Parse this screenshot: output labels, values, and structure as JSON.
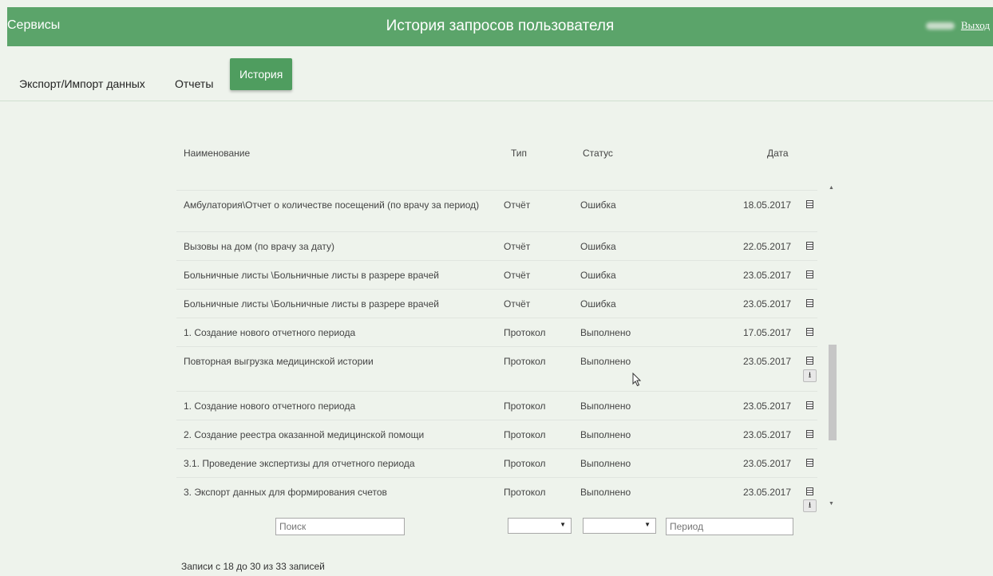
{
  "header": {
    "brand": "Сервисы",
    "title": "История запросов пользователя",
    "logout": "Выход"
  },
  "nav": {
    "tabs": [
      {
        "label": "Экспорт/Импорт данных",
        "active": false
      },
      {
        "label": "Отчеты",
        "active": false
      },
      {
        "label": "История",
        "active": true
      }
    ]
  },
  "table": {
    "columns": {
      "name": "Наименование",
      "type": "Тип",
      "status": "Статус",
      "date": "Дата"
    },
    "rows": [
      {
        "name": "Амбулатория\\Отчет о количестве посещений (по врачу за период)",
        "type": "Отчёт",
        "status": "Ошибка",
        "date": "18.05.2017",
        "icons": [
          "doc-icon"
        ]
      },
      {
        "name": "Вызовы на дом (по врачу за дату)",
        "type": "Отчёт",
        "status": "Ошибка",
        "date": "22.05.2017",
        "icons": [
          "doc-icon"
        ]
      },
      {
        "name": "Больничные листы \\Больничные листы в разрере врачей",
        "type": "Отчёт",
        "status": "Ошибка",
        "date": "23.05.2017",
        "icons": [
          "doc-icon"
        ]
      },
      {
        "name": "Больничные листы \\Больничные листы в разрере врачей",
        "type": "Отчёт",
        "status": "Ошибка",
        "date": "23.05.2017",
        "icons": [
          "doc-icon"
        ]
      },
      {
        "name": "1. Создание нового отчетного периода",
        "type": "Протокол",
        "status": "Выполнено",
        "date": "17.05.2017",
        "icons": [
          "doc-icon"
        ]
      },
      {
        "name": "Повторная выгрузка медицинской истории",
        "type": "Протокол",
        "status": "Выполнено",
        "date": "23.05.2017",
        "icons": [
          "doc-icon",
          "download-icon"
        ]
      },
      {
        "name": "1. Создание нового отчетного периода",
        "type": "Протокол",
        "status": "Выполнено",
        "date": "23.05.2017",
        "icons": [
          "doc-icon"
        ]
      },
      {
        "name": "2. Создание реестра оказанной медицинской помощи",
        "type": "Протокол",
        "status": "Выполнено",
        "date": "23.05.2017",
        "icons": [
          "doc-icon"
        ]
      },
      {
        "name": "3.1. Проведение экспертизы для отчетного периода",
        "type": "Протокол",
        "status": "Выполнено",
        "date": "23.05.2017",
        "icons": [
          "doc-icon"
        ]
      },
      {
        "name": "3. Экспорт данных для формирования счетов",
        "type": "Протокол",
        "status": "Выполнено",
        "date": "23.05.2017",
        "icons": [
          "doc-icon",
          "download-icon"
        ]
      }
    ]
  },
  "filters": {
    "search_placeholder": "Поиск",
    "type_value": "",
    "status_value": "",
    "period_placeholder": "Период"
  },
  "footer": {
    "records": "Записи с 18 до 30 из 33 записей"
  },
  "colors": {
    "topbar": "#5ba46a",
    "active_tab": "#4f9d5f",
    "background": "#eef3ec"
  }
}
